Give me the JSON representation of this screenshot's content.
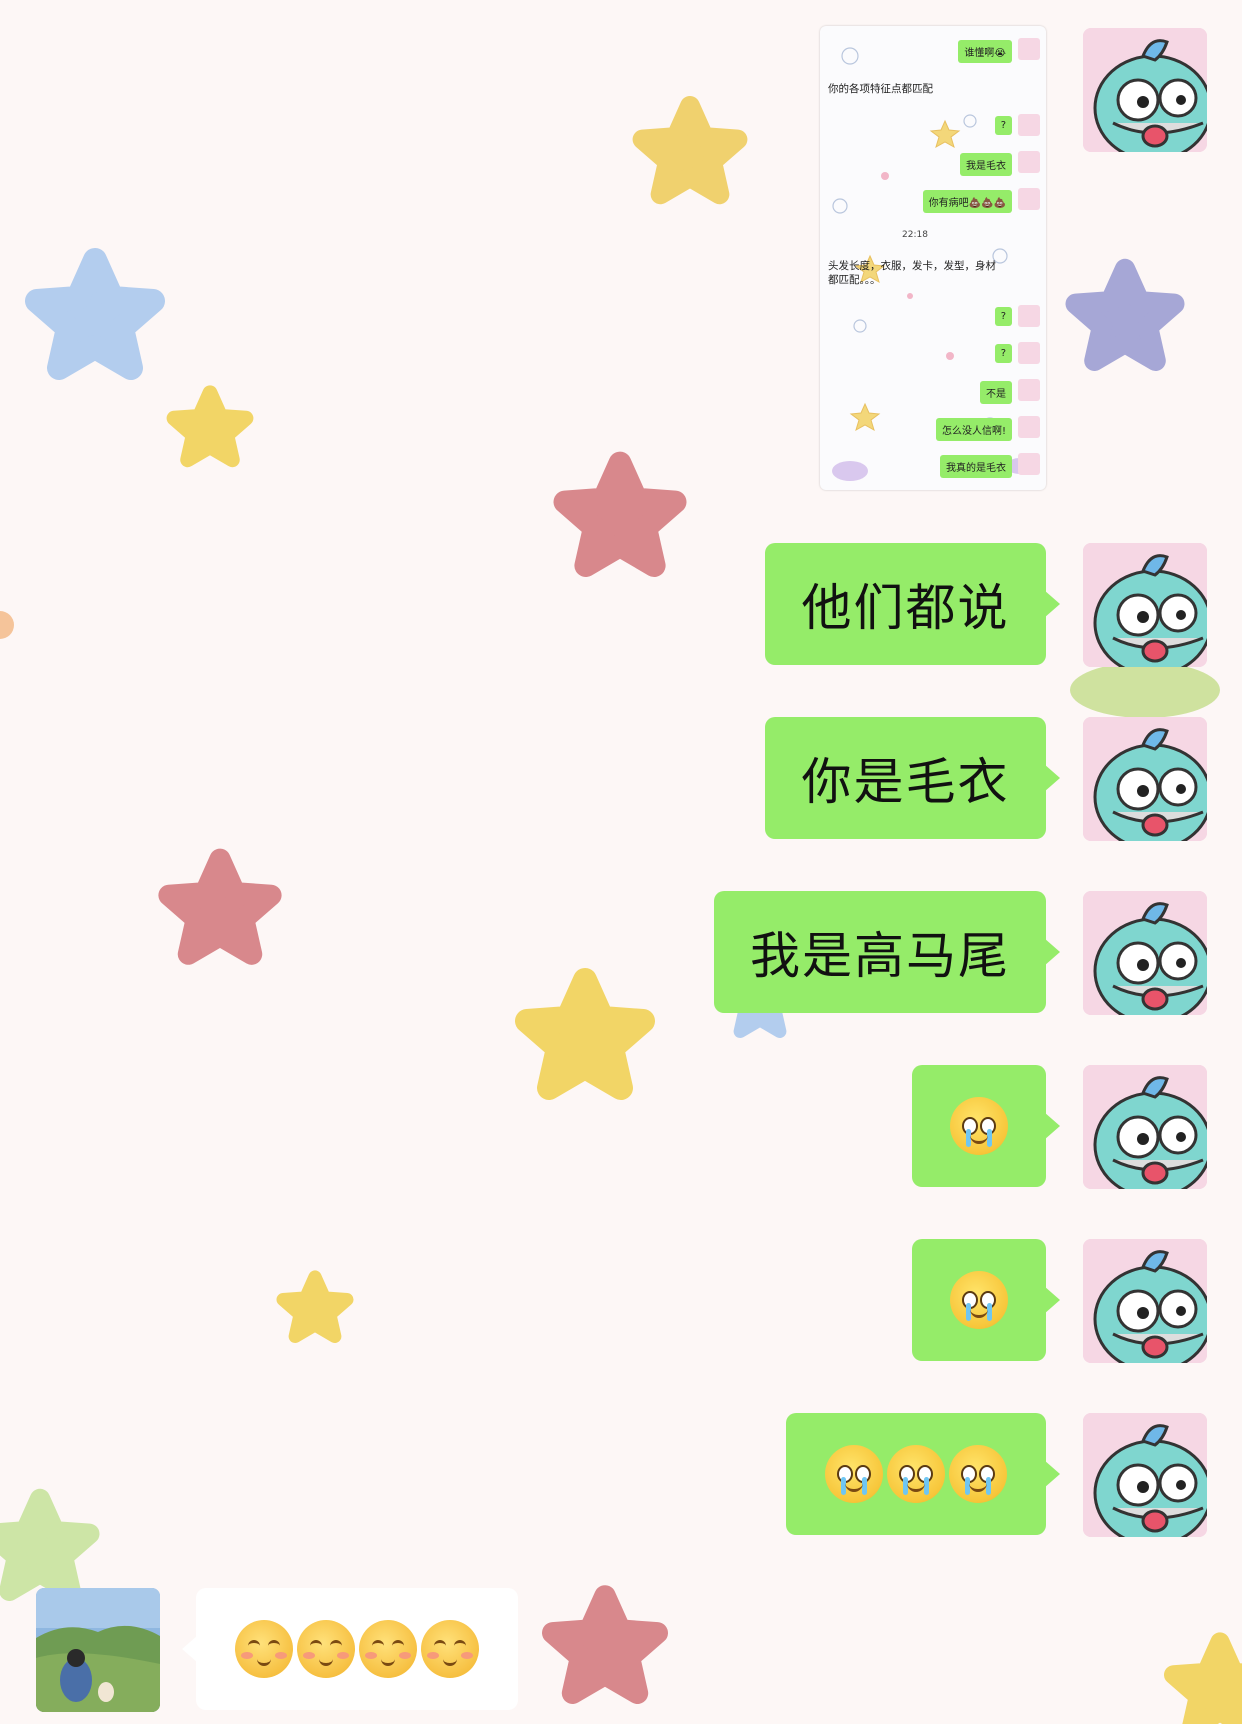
{
  "screenshot": {
    "messages": [
      {
        "side": "right",
        "text": "谁懂啊😭"
      },
      {
        "side": "left",
        "text": "你的各项特征点都匹配"
      },
      {
        "side": "right",
        "text": "?"
      },
      {
        "side": "right",
        "text": "我是毛衣"
      },
      {
        "side": "right",
        "text": "你有病吧💩💩💩"
      },
      {
        "side": "time",
        "text": "22:18"
      },
      {
        "side": "left",
        "text": "头发长度，衣服，发卡，发型，身材都匹配。。。"
      },
      {
        "side": "right",
        "text": "?"
      },
      {
        "side": "right",
        "text": "?"
      },
      {
        "side": "right",
        "text": "不是"
      },
      {
        "side": "right",
        "text": "怎么没人信啊!"
      },
      {
        "side": "right",
        "text": "我真的是毛衣"
      }
    ]
  },
  "chat": {
    "msg1": "他们都说",
    "msg2": "你是毛衣",
    "msg3": "我是高马尾",
    "msg4_emoji": "crying-face-emoji",
    "msg5_emoji": "holding-back-tears-emoji",
    "msg6_emoji": [
      "holding-back-tears-emoji",
      "holding-back-tears-emoji",
      "holding-back-tears-emoji"
    ],
    "reply_emoji": [
      "pleased-face-emoji",
      "pleased-face-emoji",
      "pleased-face-emoji",
      "pleased-face-emoji"
    ]
  },
  "colors": {
    "bubble_self": "#95ec69",
    "bubble_other": "#ffffff",
    "background": "#fdf7f6"
  }
}
